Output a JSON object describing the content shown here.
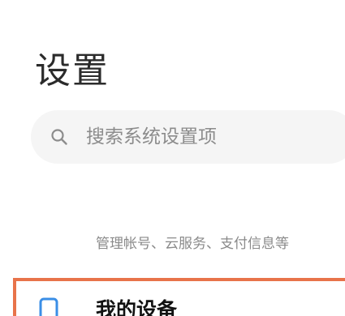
{
  "header": {
    "title": "设置"
  },
  "search": {
    "placeholder": "搜索系统设置项",
    "icon": "search-icon"
  },
  "account": {
    "subtitle": "管理帐号、云服务、支付信息等"
  },
  "device": {
    "label": "我的设备",
    "icon": "phone-icon",
    "highlight_color": "#e8734a"
  }
}
